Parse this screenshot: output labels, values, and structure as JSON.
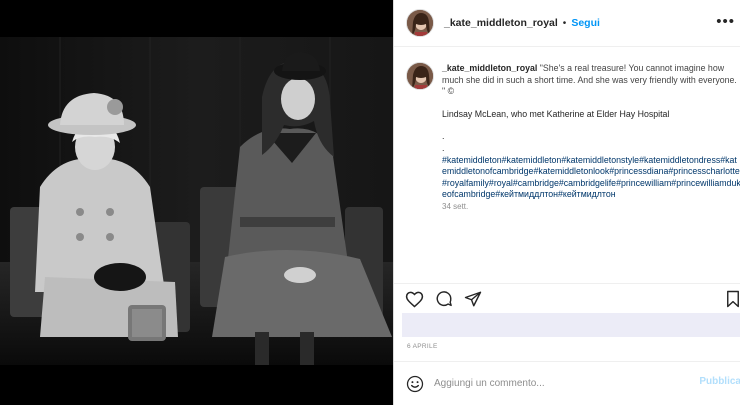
{
  "post": {
    "username": "_kate_middleton_royal",
    "separator": "•",
    "follow_label": "Segui",
    "more_label": "•••"
  },
  "caption": {
    "username": "_kate_middleton_royal",
    "quote": " \"She's a real treasure! You cannot imagine how much she did in such a short time. And she was very friendly with everyone. \" ©",
    "attribution": "Lindsay McLean, who met Katherine at Elder Hay Hospital",
    "dot1": ".",
    "dot2": ".",
    "hashtags": "#katemiddleton#katemiddleton#katemiddletonstyle#katemiddletondress#katemiddletonofcambridge#katemiddletonlook#princessdiana#princesscharlotte#royalfamily#royal#cambridge#cambridgelife#princewilliam#princewilliamdukeofcambridge#кейтмиддлтон#кейтмидлтон",
    "timestamp": "34 sett."
  },
  "date_label": "6 APRILE",
  "comment": {
    "placeholder": "Aggiungi un commento...",
    "publish_label": "Pubblica"
  },
  "icons": {
    "like": "heart-icon",
    "comment": "comment-icon",
    "share": "paper-plane-icon",
    "save": "bookmark-icon",
    "emoji": "emoji-icon",
    "more": "more-icon"
  },
  "colors": {
    "accent": "#0095f6",
    "hashtag": "#00376b",
    "muted": "#8e8e8e",
    "publish_disabled": "#b2dffc"
  }
}
